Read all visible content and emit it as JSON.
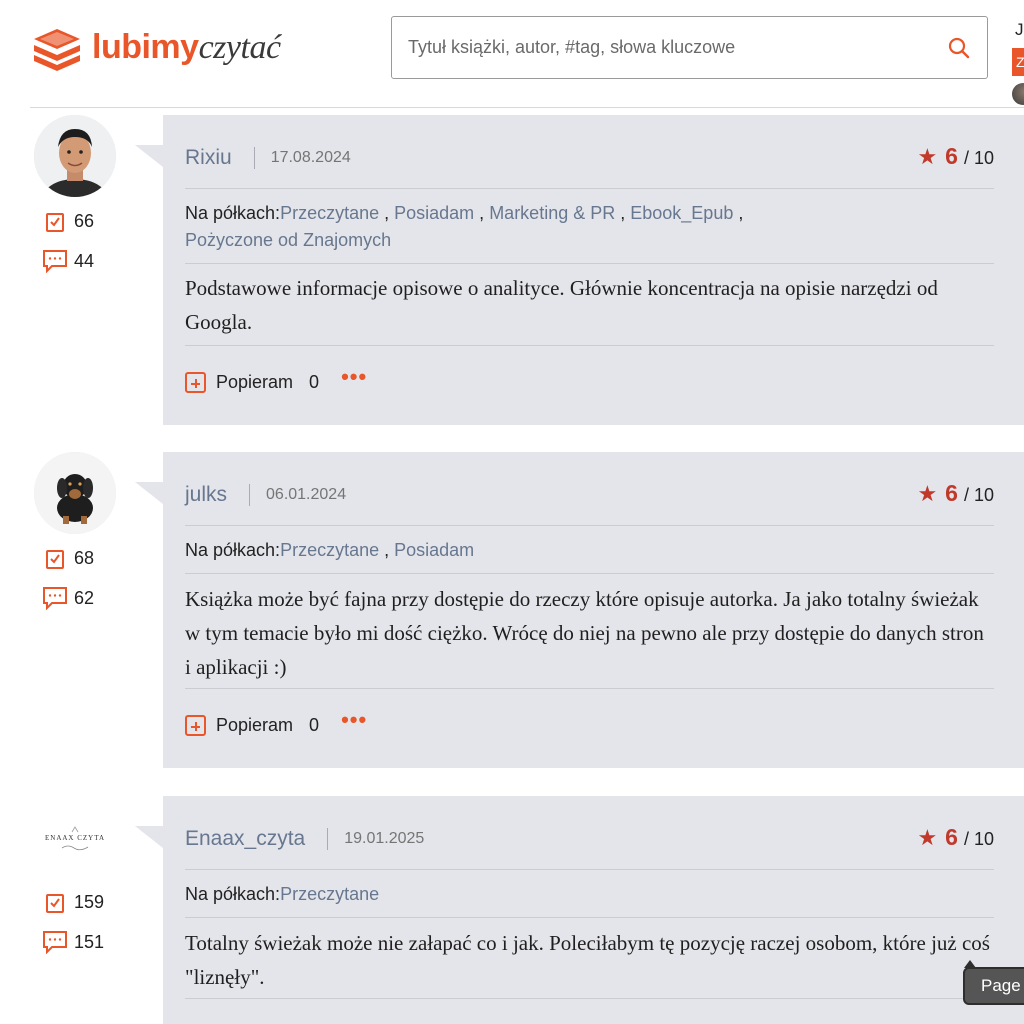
{
  "header": {
    "logo": {
      "part1": "lubimy",
      "part2": "czytać"
    },
    "search": {
      "placeholder": "Tytuł książki, autor, #tag, słowa kluczowe"
    },
    "user_letter": "J",
    "user_badge": "Z"
  },
  "colors": {
    "accent": "#e8562a",
    "link": "#67778f",
    "card_bg": "#e4e5ea",
    "rating": "#c0392b"
  },
  "reviews": [
    {
      "username": "Rixiu",
      "date": "17.08.2024",
      "rating": "6",
      "rating_of": "/ 10",
      "stat_read": "66",
      "stat_comments": "44",
      "shelves_label": "Na półkach:",
      "shelves": [
        "Przeczytane",
        "Posiadam",
        "Marketing & PR",
        "Ebook_Epub",
        "Pożyczone od Znajomych"
      ],
      "text": "Podstawowe informacje opisowe o analityce. Głównie koncentracja na opisie narzędzi od Googla.",
      "support_label": "Popieram",
      "support_count": "0"
    },
    {
      "username": "julks",
      "date": "06.01.2024",
      "rating": "6",
      "rating_of": "/ 10",
      "stat_read": "68",
      "stat_comments": "62",
      "shelves_label": "Na półkach:",
      "shelves": [
        "Przeczytane",
        "Posiadam"
      ],
      "text": "Książka może być fajna przy dostępie do rzeczy które opisuje autorka. Ja jako totalny świeżak w tym temacie było mi dość ciężko. Wrócę do niej na pewno ale przy dostępie do danych stron i aplikacji :)",
      "support_label": "Popieram",
      "support_count": "0"
    },
    {
      "username": "Enaax_czyta",
      "date": "19.01.2025",
      "rating": "6",
      "rating_of": "/ 10",
      "stat_read": "159",
      "stat_comments": "151",
      "avatar_text": "ENAAX CZYTA",
      "shelves_label": "Na półkach:",
      "shelves": [
        "Przeczytane"
      ],
      "text": "Totalny świeżak może nie załapać co i jak. Poleciłabym tę pozycję raczej osobom, które już coś \"liznęły\"."
    }
  ],
  "tooltip": "Page"
}
